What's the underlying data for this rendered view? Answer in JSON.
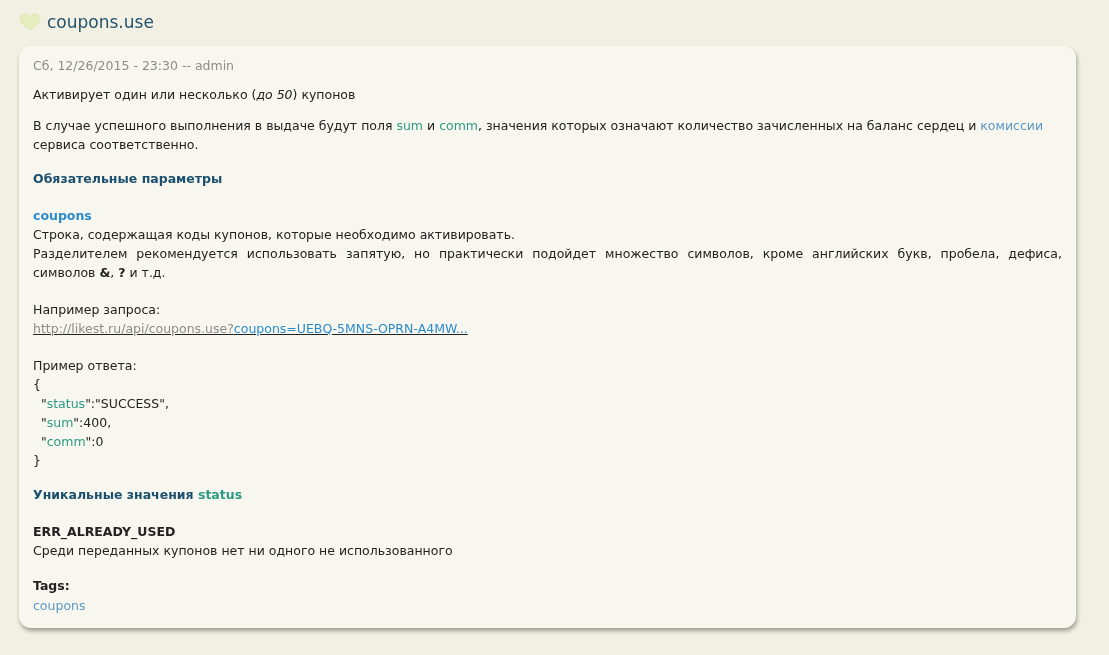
{
  "page_title": "coupons.use",
  "post": {
    "meta": "Сб, 12/26/2015 - 23:30 -- admin",
    "summary": "Активирует один или несколько (*до 50*) купонов",
    "description": [
      {
        "kind": "text",
        "text": "В случае успешного выполнения в выдаче будут поля "
      },
      {
        "kind": "code",
        "text": "sum"
      },
      {
        "kind": "text",
        "text": " и "
      },
      {
        "kind": "code",
        "text": "comm"
      },
      {
        "kind": "text",
        "text": ", значения которых означают количество зачисленных на баланс сердец и "
      },
      {
        "kind": "link",
        "text": "комиссии"
      },
      {
        "kind": "text",
        "text": " сервиса соответственно."
      }
    ],
    "required_heading": "Обязательные параметры",
    "params": [
      {
        "name": "coupons",
        "lines": [
          "Строка, содержащая коды купонов, которые необходимо активировать.",
          "Разделителем рекомендуется использовать запятую, но практически подойдет множество символов, кроме английских букв, пробела, дефиса, символов **&**, **?** и т.д."
        ]
      }
    ],
    "request_label": "Например запроса:",
    "request_url": [
      {
        "kind": "base",
        "text": "http://likest.ru/api/coupons.use?"
      },
      {
        "kind": "param",
        "text": "coupons=UEBQ-5MNS-OPRN-A4MW..."
      }
    ],
    "response_label": "Пример ответа:",
    "response": [
      [
        {
          "kind": "text",
          "text": "{"
        }
      ],
      [
        {
          "kind": "text",
          "text": "  \""
        },
        {
          "kind": "code",
          "text": "status"
        },
        {
          "kind": "text",
          "text": "\":\"SUCCESS\","
        }
      ],
      [
        {
          "kind": "text",
          "text": "  \""
        },
        {
          "kind": "code",
          "text": "sum"
        },
        {
          "kind": "text",
          "text": "\":400,"
        }
      ],
      [
        {
          "kind": "text",
          "text": "  \""
        },
        {
          "kind": "code",
          "text": "comm"
        },
        {
          "kind": "text",
          "text": "\":0"
        }
      ],
      [
        {
          "kind": "text",
          "text": "}"
        }
      ]
    ],
    "values_heading": [
      {
        "kind": "text",
        "text": "Уникальные значения "
      },
      {
        "kind": "code",
        "text": "status"
      }
    ],
    "errors": [
      {
        "code": "ERR_ALREADY_USED",
        "description": "Среди переданных купонов нет ни одного не использованного"
      }
    ],
    "tags_label": "Tags:",
    "tags": [
      "coupons"
    ]
  }
}
